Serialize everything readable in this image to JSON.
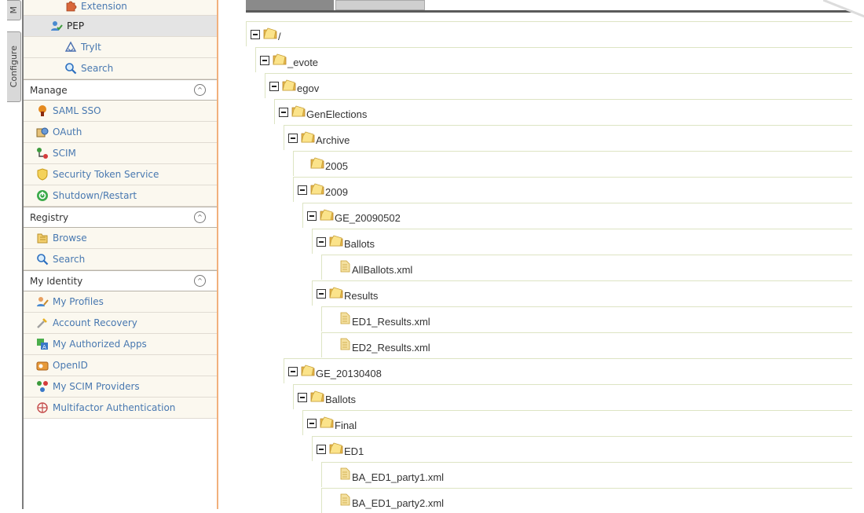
{
  "vertical_tabs": {
    "manage_short": "M",
    "configure": "Configure"
  },
  "sidebar": {
    "config_items": [
      {
        "label": "Extension",
        "icon": "puzzle-icon",
        "level": 3
      },
      {
        "label": "PEP",
        "icon": "pep-user-icon",
        "level": 2,
        "active": true
      },
      {
        "label": "TryIt",
        "icon": "tryit-icon",
        "level": 3
      },
      {
        "label": "Search",
        "icon": "search-icon",
        "level": 3
      }
    ],
    "manage": {
      "title": "Manage",
      "items": [
        {
          "label": "SAML SSO",
          "icon": "saml-icon"
        },
        {
          "label": "OAuth",
          "icon": "oauth-icon"
        },
        {
          "label": "SCIM",
          "icon": "scim-icon"
        },
        {
          "label": "Security Token Service",
          "icon": "shield-icon"
        },
        {
          "label": "Shutdown/Restart",
          "icon": "power-icon"
        }
      ]
    },
    "registry": {
      "title": "Registry",
      "items": [
        {
          "label": "Browse",
          "icon": "browse-icon"
        },
        {
          "label": "Search",
          "icon": "search-icon"
        }
      ]
    },
    "identity": {
      "title": "My Identity",
      "items": [
        {
          "label": "My Profiles",
          "icon": "profile-icon"
        },
        {
          "label": "Account Recovery",
          "icon": "recovery-icon"
        },
        {
          "label": "My Authorized Apps",
          "icon": "apps-icon"
        },
        {
          "label": "OpenID",
          "icon": "openid-icon"
        },
        {
          "label": "My SCIM Providers",
          "icon": "scim-providers-icon"
        },
        {
          "label": "Multifactor Authentication",
          "icon": "mfa-icon"
        }
      ]
    }
  },
  "tree": [
    {
      "label": "/",
      "type": "folder",
      "depth": 0,
      "expanded": true
    },
    {
      "label": "_evote",
      "type": "folder",
      "depth": 1,
      "expanded": true
    },
    {
      "label": "egov",
      "type": "folder",
      "depth": 2,
      "expanded": true
    },
    {
      "label": "GenElections",
      "type": "folder",
      "depth": 3,
      "expanded": true
    },
    {
      "label": "Archive",
      "type": "folder",
      "depth": 4,
      "expanded": true
    },
    {
      "label": "2005",
      "type": "folder",
      "depth": 5,
      "expanded": false
    },
    {
      "label": "2009",
      "type": "folder",
      "depth": 5,
      "expanded": true
    },
    {
      "label": "GE_20090502",
      "type": "folder",
      "depth": 6,
      "expanded": true
    },
    {
      "label": "Ballots",
      "type": "folder",
      "depth": 7,
      "expanded": true
    },
    {
      "label": "AllBallots.xml",
      "type": "file",
      "depth": 8
    },
    {
      "label": "Results",
      "type": "folder",
      "depth": 7,
      "expanded": true
    },
    {
      "label": "ED1_Results.xml",
      "type": "file",
      "depth": 8
    },
    {
      "label": "ED2_Results.xml",
      "type": "file",
      "depth": 8
    },
    {
      "label": "GE_20130408",
      "type": "folder",
      "depth": 4,
      "expanded": true
    },
    {
      "label": "Ballots",
      "type": "folder",
      "depth": 5,
      "expanded": true
    },
    {
      "label": "Final",
      "type": "folder",
      "depth": 6,
      "expanded": true
    },
    {
      "label": "ED1",
      "type": "folder",
      "depth": 7,
      "expanded": true
    },
    {
      "label": "BA_ED1_party1.xml",
      "type": "file",
      "depth": 8
    },
    {
      "label": "BA_ED1_party2.xml",
      "type": "file",
      "depth": 8
    }
  ],
  "colors": {
    "link": "#4878b0",
    "sidebar_border": "#f1b07c",
    "folder": "#f5c542"
  }
}
